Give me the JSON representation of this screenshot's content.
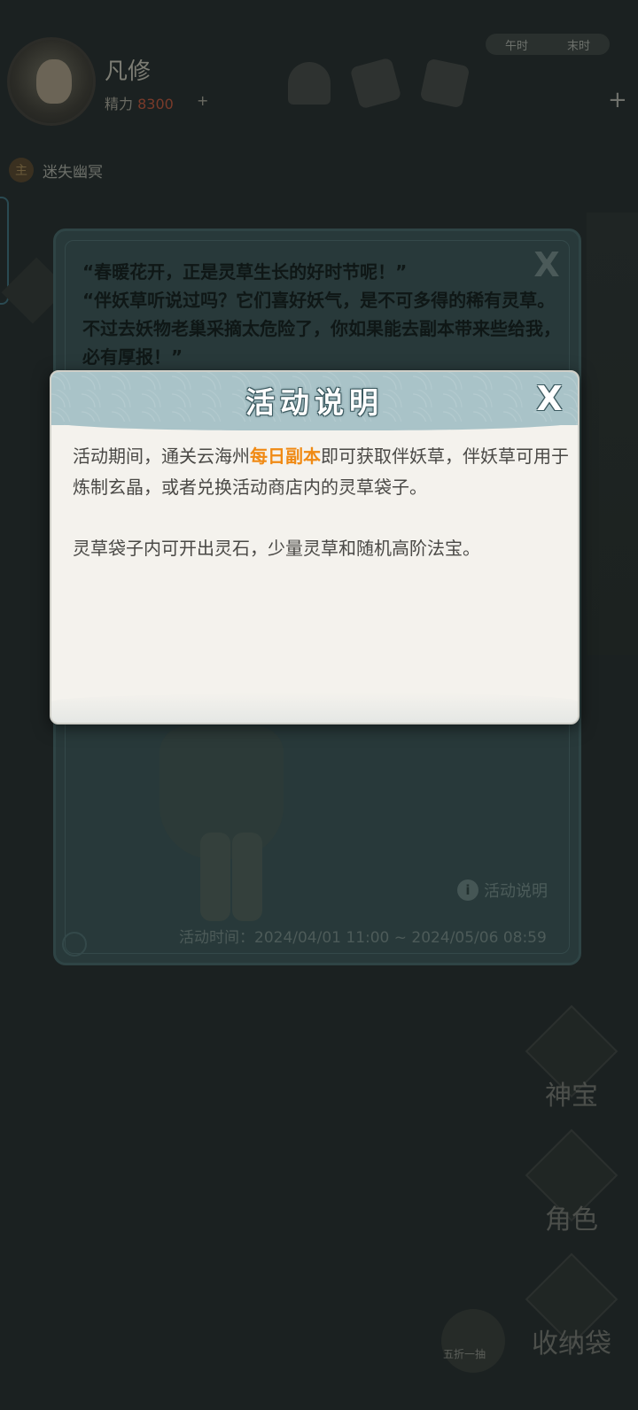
{
  "player": {
    "name": "凡修",
    "power_label": "精力",
    "power_value": "8300",
    "plus": "+"
  },
  "top_bar": {
    "time_labels": [
      "午时",
      "末时"
    ],
    "plus": "+"
  },
  "task": {
    "badge": "主",
    "text": "迷失幽冥"
  },
  "side_buttons": [
    {
      "label": "神宝",
      "icon": "treasure-icon"
    },
    {
      "label": "角色",
      "icon": "character-icon"
    },
    {
      "label": "收纳袋",
      "icon": "bag-icon"
    }
  ],
  "bottom_button": {
    "label": "五折一抽"
  },
  "activity_panel": {
    "quote_1": "“春暖花开，正是灵草生长的好时节呢！”",
    "quote_2": "“伴妖草听说过吗？它们喜好妖气，是不可多得的稀有灵草。不过去妖物老巢采摘太危险了，你如果能去副本带来些给我，必有厚报！”",
    "close": "X",
    "info_link": "活动说明",
    "info_icon": "i",
    "time_text": "活动时间：2024/04/01 11:00 ~ 2024/05/06 08:59"
  },
  "dialog": {
    "title": "活动说明",
    "close": "X",
    "para1_before": "活动期间，通关云海州",
    "para1_highlight": "每日副本",
    "para1_after": "即可获取伴妖草，伴妖草可用于炼制玄晶，或者兑换活动商店内的灵草袋子。",
    "para2": "灵草袋子内可开出灵石，少量灵草和随机高阶法宝。",
    "highlight_color": "#f08a14"
  }
}
